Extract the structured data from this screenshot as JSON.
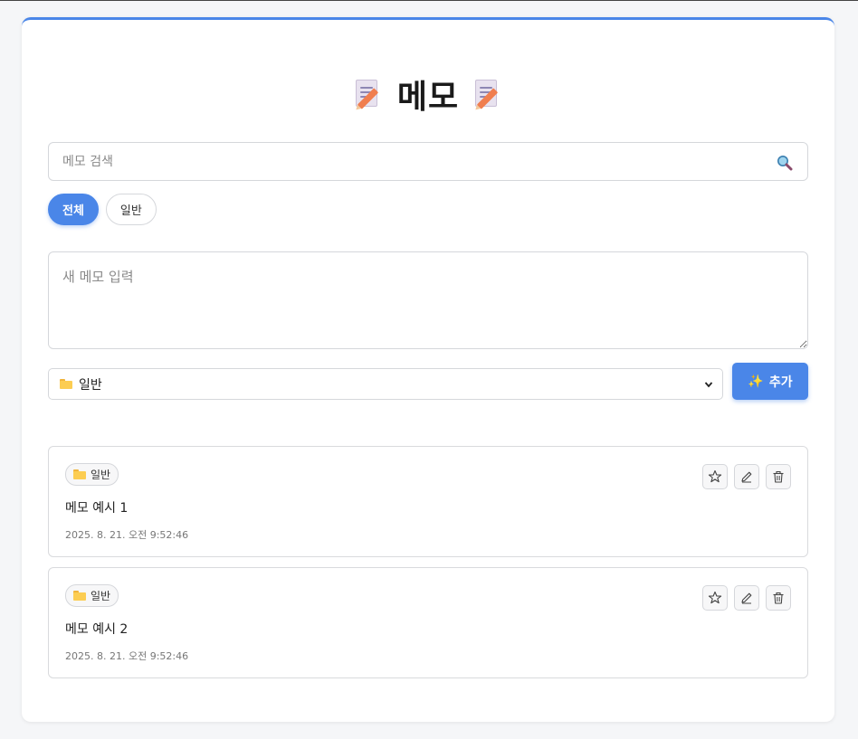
{
  "header": {
    "title": "메모"
  },
  "search": {
    "placeholder": "메모 검색",
    "icon": "magnifier-icon"
  },
  "filters": [
    {
      "label": "전체",
      "active": true
    },
    {
      "label": "일반",
      "active": false
    }
  ],
  "composer": {
    "placeholder": "새 메모 입력",
    "category_selected": "일반",
    "add_label": "추가"
  },
  "memos": [
    {
      "category": "일반",
      "text": "메모 예시 1",
      "date": "2025. 8. 21. 오전 9:52:46"
    },
    {
      "category": "일반",
      "text": "메모 예시 2",
      "date": "2025. 8. 21. 오전 9:52:46"
    }
  ],
  "colors": {
    "accent": "#4a86e8",
    "folder": "#fccd52"
  }
}
